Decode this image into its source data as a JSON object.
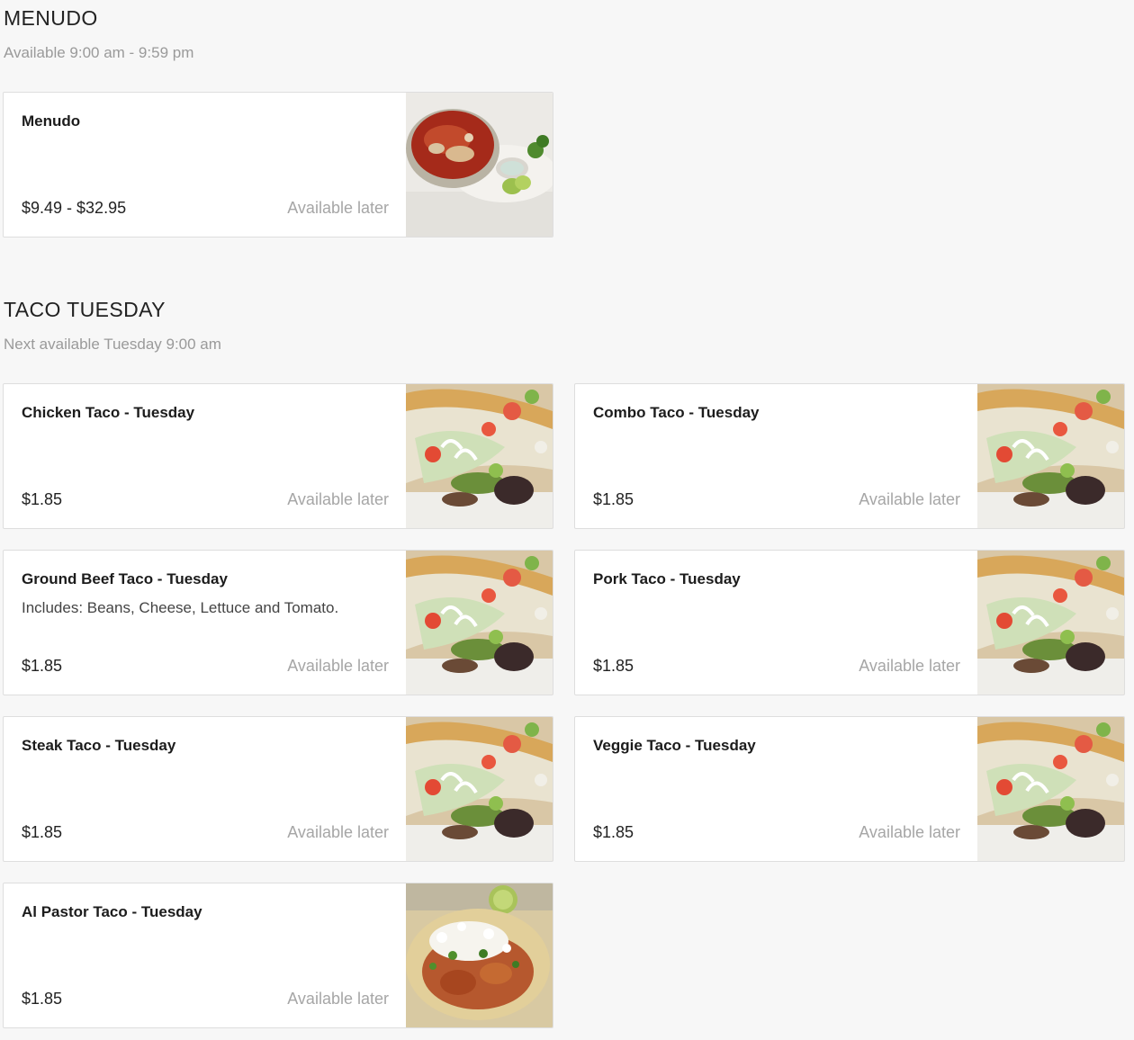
{
  "sections": [
    {
      "title": "MENUDO",
      "subtitle": "Available 9:00 am - 9:59 pm",
      "items": [
        {
          "name": "Menudo",
          "description": "",
          "price": "$9.49 - $32.95",
          "status": "Available later",
          "image": "menudo-soup-image"
        }
      ]
    },
    {
      "title": "TACO TUESDAY",
      "subtitle": "Next available Tuesday 9:00 am",
      "items": [
        {
          "name": "Chicken Taco - Tuesday",
          "description": "",
          "price": "$1.85",
          "status": "Available later",
          "image": "taco-plate-image"
        },
        {
          "name": "Combo Taco - Tuesday",
          "description": "",
          "price": "$1.85",
          "status": "Available later",
          "image": "taco-plate-image"
        },
        {
          "name": "Ground Beef Taco - Tuesday",
          "description": "Includes: Beans, Cheese, Lettuce and Tomato.",
          "price": "$1.85",
          "status": "Available later",
          "image": "taco-plate-image"
        },
        {
          "name": "Pork Taco - Tuesday",
          "description": "",
          "price": "$1.85",
          "status": "Available later",
          "image": "taco-plate-image"
        },
        {
          "name": "Steak Taco - Tuesday",
          "description": "",
          "price": "$1.85",
          "status": "Available later",
          "image": "taco-plate-image"
        },
        {
          "name": "Veggie Taco - Tuesday",
          "description": "",
          "price": "$1.85",
          "status": "Available later",
          "image": "taco-plate-image"
        },
        {
          "name": "Al Pastor Taco - Tuesday",
          "description": "",
          "price": "$1.85",
          "status": "Available later",
          "image": "al-pastor-taco-image"
        }
      ]
    }
  ],
  "colors": {
    "background": "#f7f7f7",
    "card": "#ffffff",
    "muted": "#a6a6a6",
    "text": "#1c1c1c"
  }
}
